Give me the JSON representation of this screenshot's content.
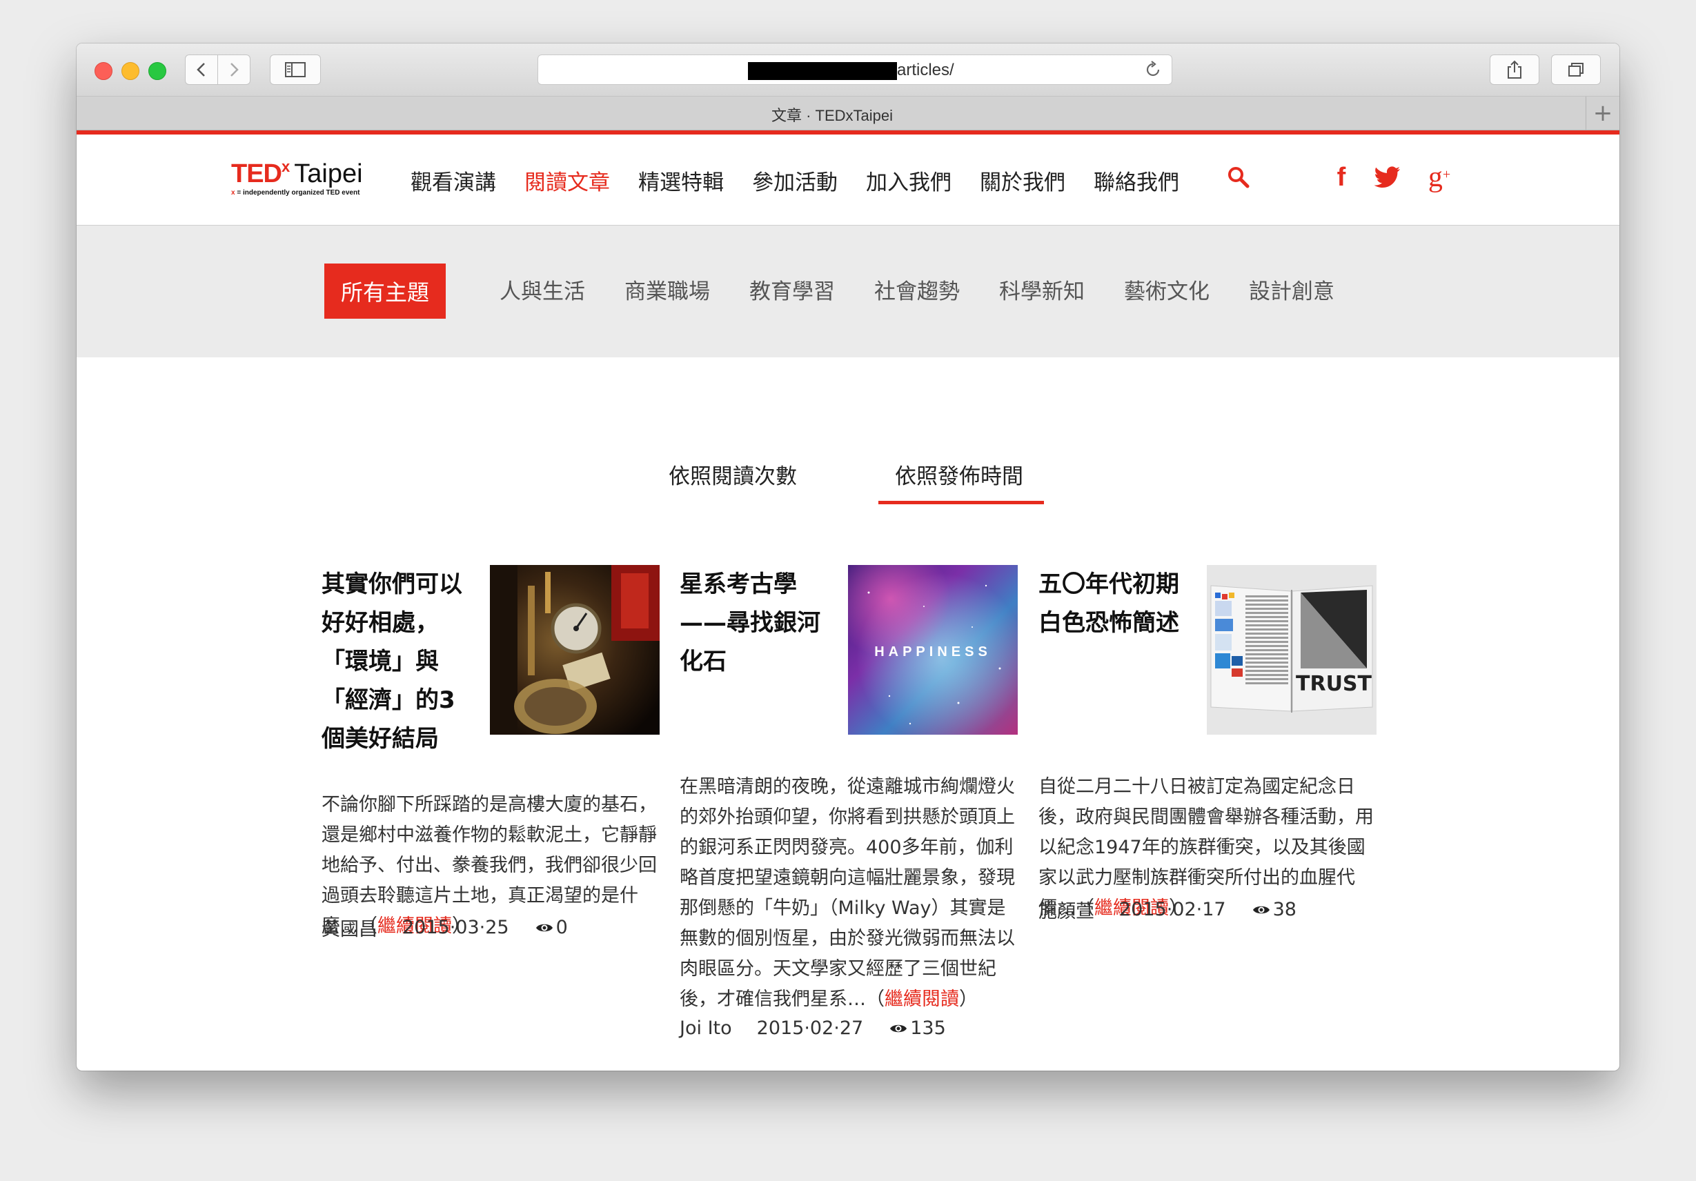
{
  "browser": {
    "url_visible": "articles/",
    "tab_title": "文章 · TEDxTaipei",
    "new_tab_glyph": "+"
  },
  "site": {
    "logo": {
      "ted": "TED",
      "x": "x",
      "city": "Taipei",
      "tagline_x": "x",
      "tagline": " = independently organized TED event"
    },
    "nav": [
      "觀看演講",
      "閱讀文章",
      "精選特輯",
      "參加活動",
      "加入我們",
      "關於我們",
      "聯絡我們"
    ],
    "nav_active_index": 1,
    "search_icon": "search-icon",
    "social": {
      "facebook": "f",
      "googleplus": "g",
      "googleplus_sup": "+"
    },
    "topics_active": "所有主題",
    "topics": [
      "人與生活",
      "商業職場",
      "教育學習",
      "社會趨勢",
      "科學新知",
      "藝術文化",
      "設計創意"
    ],
    "sort": {
      "by_reads": "依照閱讀次數",
      "by_time": "依照發佈時間",
      "active": "by_time"
    },
    "colors": {
      "brand_red": "#e62b1e",
      "topics_bg": "#ebebeb"
    }
  },
  "articles": [
    {
      "title_lines": [
        "其實你們可以",
        "好好相處，",
        "「環境」與",
        "「經濟」的3",
        "個美好結局"
      ],
      "excerpt": "不論你腳下所踩踏的是高樓大廈的基石，還是鄉村中滋養作物的鬆軟泥土，它靜靜地給予、付出、豢養我們，我們卻很少回過頭去聆聽這片土地，真正渴望的是什麼…（",
      "more": "繼續閱讀",
      "close": "）",
      "author": "黃國昌",
      "date": "2015·03·25",
      "views": "0"
    },
    {
      "title_lines": [
        "星系考古學",
        "——尋找銀河",
        "化石"
      ],
      "thumb_text": "HAPPINESS",
      "excerpt": "在黑暗清朗的夜晚，從遠離城市絢爛燈火的郊外抬頭仰望，你將看到拱懸於頭頂上的銀河系正閃閃發亮。400多年前，伽利略首度把望遠鏡朝向這幅壯麗景象，發現那倒懸的「牛奶」（Milky Way）其實是無數的個別恆星，由於發光微弱而無法以肉眼區分。天文學家又經歷了三個世紀後，才確信我們星系…（",
      "more": "繼續閱讀",
      "close": "）",
      "author": "Joi Ito",
      "date": "2015·02·27",
      "views": "135"
    },
    {
      "title_lines": [
        "五〇年代初期",
        "白色恐怖簡述"
      ],
      "thumb_text": "TRUST",
      "excerpt": "自從二月二十八日被訂定為國定紀念日後，政府與民間團體會舉辦各種活動，用以紀念1947年的族群衝突，以及其後國家以武力壓制族群衝突所付出的血腥代價…（",
      "more": "繼續閱讀",
      "close": "）",
      "author": "施顏萱",
      "date": "2015·02·17",
      "views": "38"
    }
  ]
}
